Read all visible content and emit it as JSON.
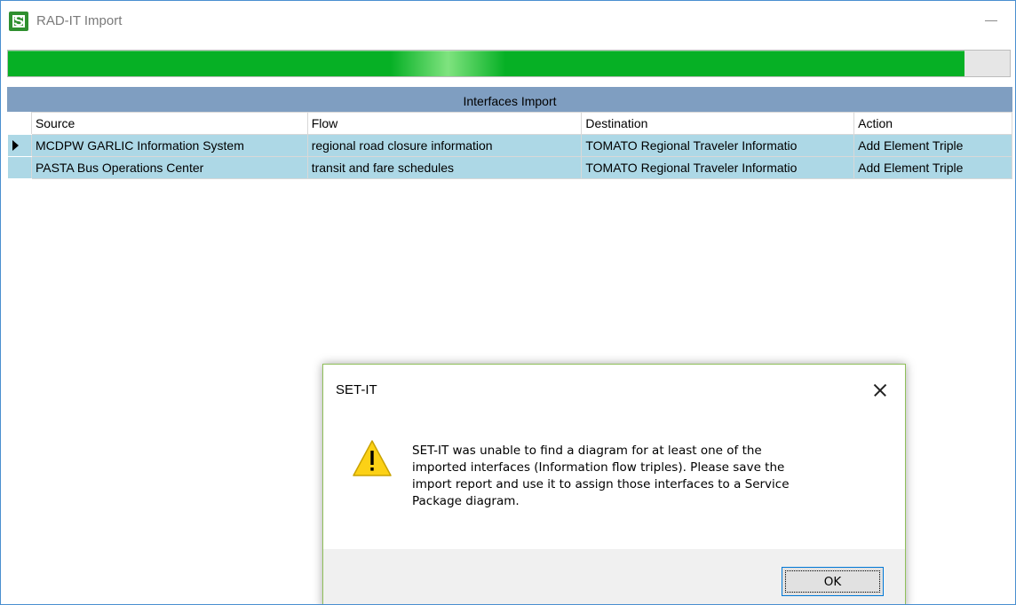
{
  "window": {
    "title": "RAD-IT Import",
    "icon_letter": "S"
  },
  "progress": {
    "fraction": 0.955,
    "color": "#06b025"
  },
  "grid": {
    "title": "Interfaces Import",
    "columns": [
      "Source",
      "Flow",
      "Destination",
      "Action"
    ],
    "rows": [
      [
        "MCDPW GARLIC Information System",
        "regional road closure information",
        "TOMATO Regional Traveler Informatio",
        "Add Element Triple"
      ],
      [
        "PASTA Bus Operations Center",
        "transit and fare schedules",
        "TOMATO Regional Traveler Informatio",
        "Add Element Triple"
      ]
    ],
    "selected_row_color": "#add8e6",
    "header_color": "#7f9ec1"
  },
  "dialog": {
    "title": "SET-IT",
    "message_lines": [
      "SET-IT was unable to find a diagram for at least one of the",
      "imported interfaces (Information flow triples). Please save the",
      "import report and use it to assign those interfaces to a Service",
      "Package diagram."
    ],
    "ok_label": "OK",
    "icon": "warning-icon"
  }
}
